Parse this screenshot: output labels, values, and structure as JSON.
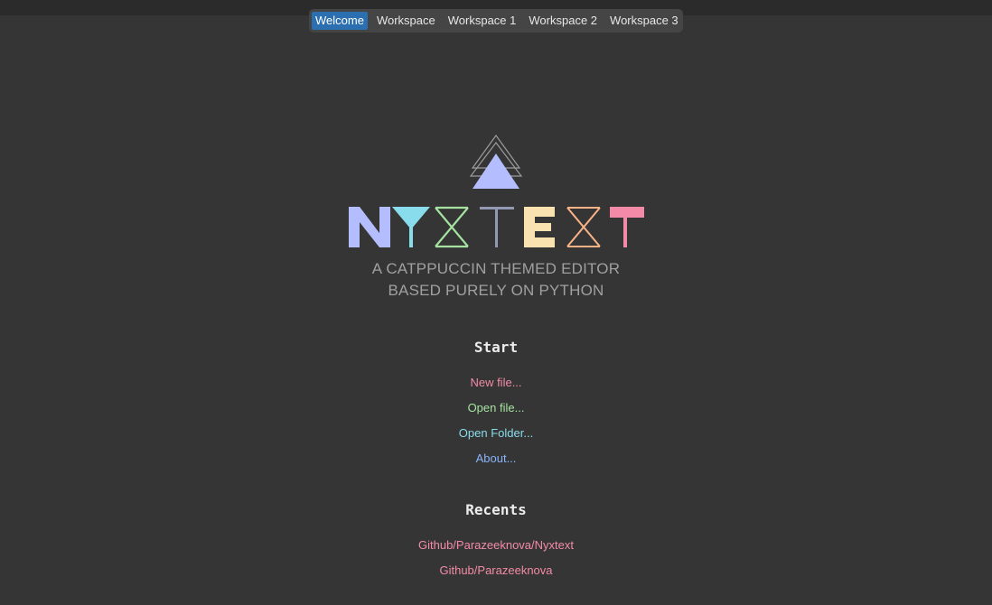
{
  "tabs": [
    {
      "label": "Welcome",
      "active": true
    },
    {
      "label": "Workspace",
      "active": false
    },
    {
      "label": "Workspace 1",
      "active": false
    },
    {
      "label": "Workspace 2",
      "active": false
    },
    {
      "label": "Workspace 3",
      "active": false
    }
  ],
  "logo": {
    "wordmark": "NYXTEXT",
    "tagline_line1": "A CATPPUCCIN THEMED  EDITOR",
    "tagline_line2": "BASED PURELY ON PYTHON",
    "colors": {
      "N": "#b4befe",
      "Y": "#89dceb",
      "X1": "#a6e3a1",
      "T1": "#9399b2",
      "E": "#f9e2af",
      "X2": "#fab387",
      "T2": "#f38ba8",
      "triangle": "#b4befe"
    }
  },
  "start": {
    "title": "Start",
    "items": [
      {
        "label": "New file...",
        "color": "#f38ba8"
      },
      {
        "label": "Open file...",
        "color": "#a6e3a1"
      },
      {
        "label": "Open Folder...",
        "color": "#89dceb"
      },
      {
        "label": "About...",
        "color": "#89b4fa"
      }
    ]
  },
  "recents": {
    "title": "Recents",
    "items": [
      {
        "label": "Github/Parazeeknova/Nyxtext",
        "color": "#f38ba8"
      },
      {
        "label": "Github/Parazeeknova",
        "color": "#f38ba8"
      }
    ]
  }
}
